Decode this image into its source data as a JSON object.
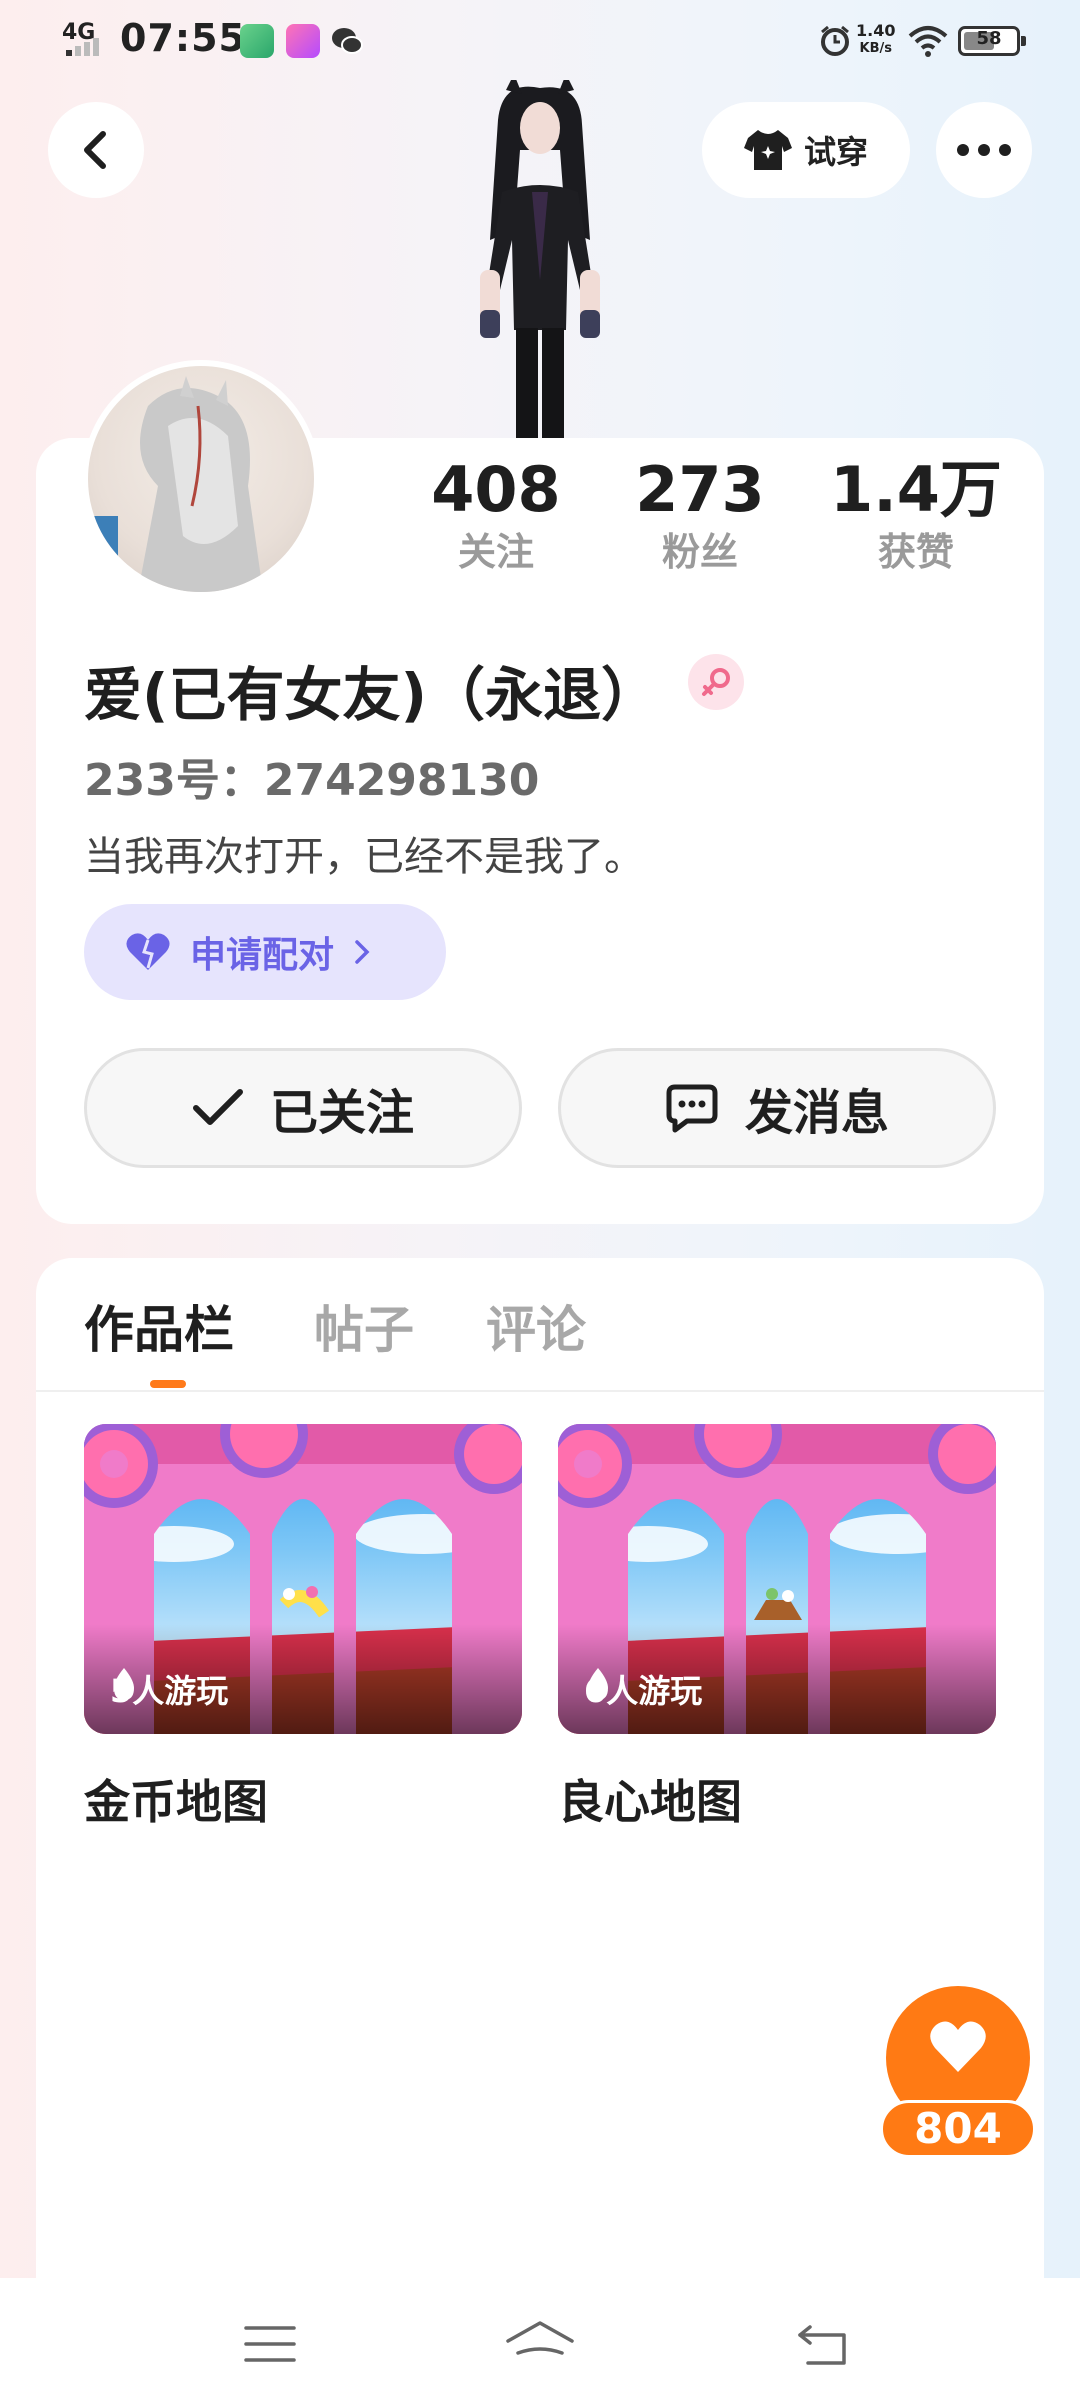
{
  "status_bar": {
    "network": "4G",
    "time": "07:55",
    "net_speed_value": "1.40",
    "net_speed_unit": "KB/s",
    "battery": "58"
  },
  "header": {
    "try_on_label": "试穿"
  },
  "profile": {
    "stats": [
      {
        "value": "408",
        "label": "关注"
      },
      {
        "value": "273",
        "label": "粉丝"
      },
      {
        "value": "1.4万",
        "label": "获赞"
      }
    ],
    "username": "爱(已有女友)（永退）",
    "uid": "233号：274298130",
    "bio": "当我再次打开，已经不是我了。",
    "pair_label": "申请配对",
    "follow_label": "已关注",
    "message_label": "发消息"
  },
  "tabs": [
    {
      "label": "作品栏",
      "active": true
    },
    {
      "label": "帖子",
      "active": false
    },
    {
      "label": "评论",
      "active": false
    }
  ],
  "works": [
    {
      "title": "金币地图",
      "players": "5人游玩"
    },
    {
      "title": "良心地图",
      "players": "6人游玩"
    }
  ],
  "like": {
    "count": "804"
  },
  "colors": {
    "accent_orange": "#ff7a14",
    "pair_purple": "#6a63e6",
    "pair_bg": "#e6e4fd",
    "gender_pink": "#f06a8c"
  },
  "icons": [
    "back-icon",
    "shirt-icon",
    "more-icon",
    "heart-icon",
    "check-icon",
    "chat-icon",
    "fire-icon",
    "female-icon",
    "menu-icon",
    "home-icon",
    "return-icon"
  ]
}
